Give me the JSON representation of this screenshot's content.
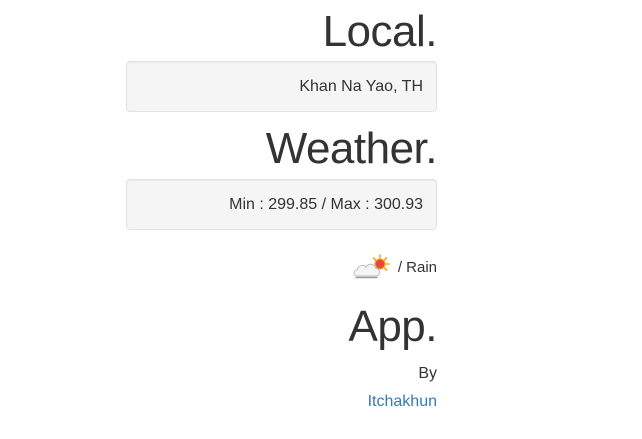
{
  "local": {
    "heading": "Local.",
    "location": "Khan Na Yao, TH"
  },
  "weather": {
    "heading": "Weather.",
    "temperature": "Min : 299.85 / Max : 300.93",
    "icon": "partly-sunny-cloud-icon",
    "condition": "/ Rain"
  },
  "app": {
    "heading": "App.",
    "by_label": "By",
    "author": "Itchakhun",
    "link_color": "#337ab7"
  }
}
